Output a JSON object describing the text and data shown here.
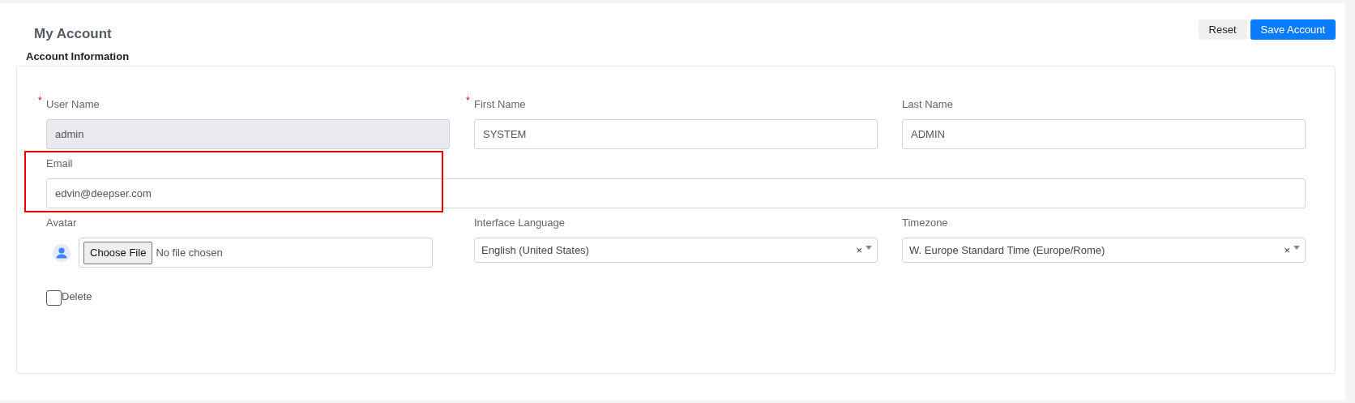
{
  "header": {
    "title": "My Account",
    "buttons": [
      {
        "label": "Reset",
        "kind": "secondary"
      },
      {
        "label": "Save Account",
        "kind": "primary"
      }
    ]
  },
  "section": {
    "title": "Account Information"
  },
  "fields": [
    {
      "label": "User Name",
      "required_mark": "*",
      "kind": "text",
      "value": "admin",
      "disabled": true
    },
    {
      "label": "First Name",
      "required_mark": "*",
      "kind": "text",
      "value": "SYSTEM",
      "disabled": false
    },
    {
      "label": "Last Name",
      "kind": "text",
      "value": "ADMIN",
      "disabled": false
    },
    {
      "label": "Email",
      "kind": "wide",
      "value": "edvin@deepser.com",
      "disabled": false,
      "highlighted": true
    },
    {
      "label": "Avatar",
      "kind": "file",
      "button": "Choose File",
      "status": "No file chosen"
    },
    {
      "label": "Interface Language",
      "kind": "select",
      "value": "English (United States)",
      "clear": "×"
    },
    {
      "label": "Timezone",
      "kind": "select",
      "value": "W. Europe Standard Time (Europe/Rome)",
      "clear": "×"
    }
  ],
  "delete": {
    "label": "Delete",
    "checked": false
  }
}
